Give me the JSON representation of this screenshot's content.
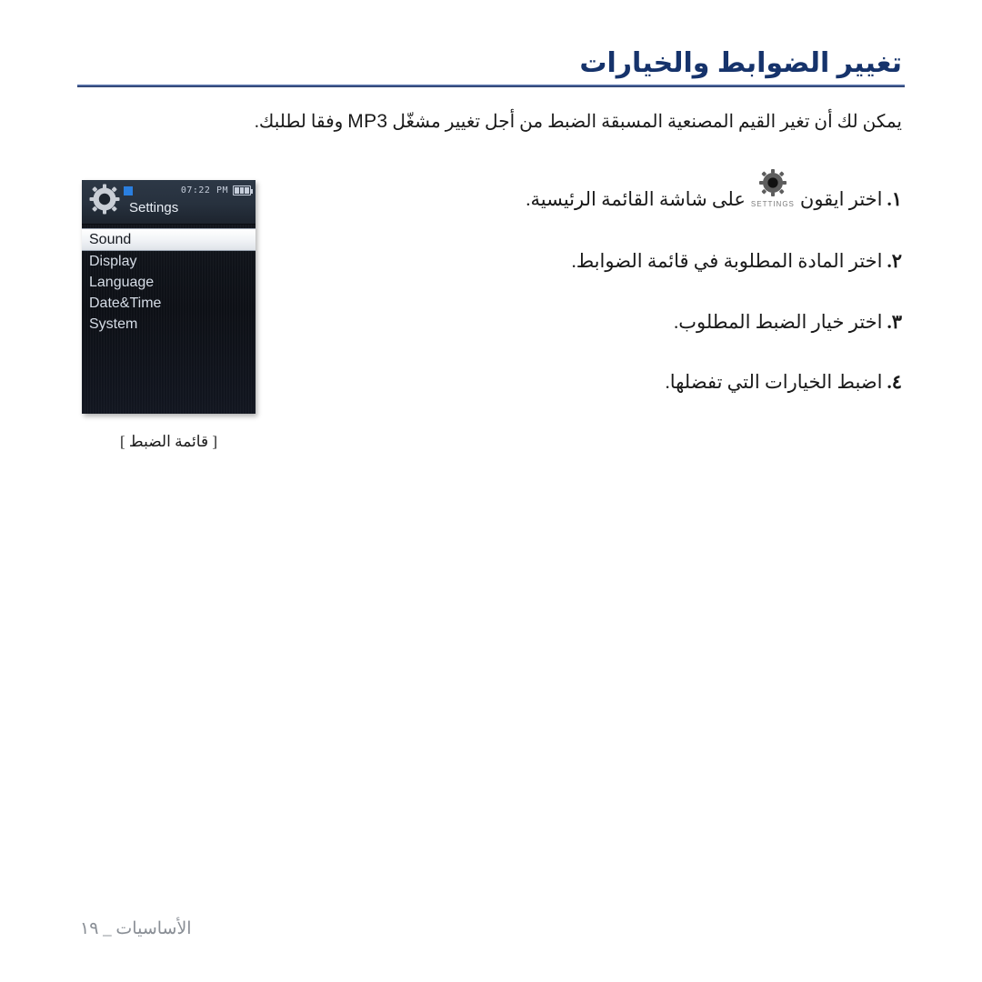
{
  "document": {
    "title": "تغيير الضوابط والخيارات",
    "intro_before": "يمكن لك أن تغير القيم المصنعية المسبقة الضبط من أجل تغيير مشغّل ",
    "intro_latin": "MP3",
    "intro_after": " وفقا لطلبك.",
    "accent_color": "#16336b",
    "rule_color": "#2b3f6e"
  },
  "device": {
    "header": {
      "title": "Settings",
      "time": "07:22 PM",
      "gear_icon": "gear-icon",
      "battery_icon": "battery-icon",
      "battery_bars": 3,
      "indicator_color": "#2a7fe0"
    },
    "menu": [
      {
        "label": "Sound",
        "selected": true
      },
      {
        "label": "Display",
        "selected": false
      },
      {
        "label": "Language",
        "selected": false
      },
      {
        "label": "Date&Time",
        "selected": false
      },
      {
        "label": "System",
        "selected": false
      }
    ],
    "caption": "[ قائمة الضبط ]"
  },
  "steps": [
    {
      "num": "١.",
      "text_before": "اختر ايقون",
      "icon": "settings-gear-icon",
      "icon_caption": "SETTINGS",
      "text_after": "على شاشة القائمة الرئيسية."
    },
    {
      "num": "٢.",
      "text": "اختر المادة المطلوبة في قائمة الضوابط."
    },
    {
      "num": "٣.",
      "text": "اختر خيار الضبط المطلوب."
    },
    {
      "num": "٤.",
      "text": "اضبط الخيارات التي تفضلها."
    }
  ],
  "footer": {
    "text": "الأساسيات _ ١٩"
  }
}
